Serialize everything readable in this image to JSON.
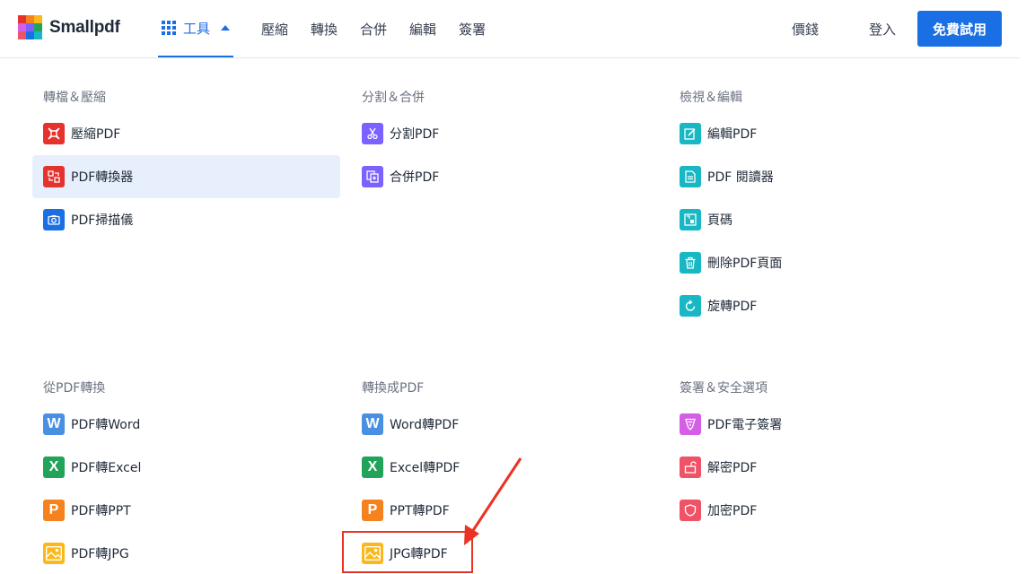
{
  "brand": {
    "name": "Smallpdf"
  },
  "nav": {
    "tools": "工具",
    "items": [
      "壓縮",
      "轉換",
      "合併",
      "編輯",
      "簽署"
    ],
    "pricing": "價錢",
    "login": "登入",
    "trial": "免費試用"
  },
  "sections": [
    {
      "title": "轉檔＆壓縮",
      "items": [
        {
          "label": "壓縮PDF",
          "icon": "compress-icon",
          "color": "#e5322d"
        },
        {
          "label": "PDF轉換器",
          "icon": "convert-icon",
          "color": "#e5322d",
          "active": true
        },
        {
          "label": "PDF掃描儀",
          "icon": "camera-icon",
          "color": "#1a6fe5"
        }
      ]
    },
    {
      "title": "分割＆合併",
      "items": [
        {
          "label": "分割PDF",
          "icon": "scissors-icon",
          "color": "#7b61ff"
        },
        {
          "label": "合併PDF",
          "icon": "merge-icon",
          "color": "#7b61ff"
        }
      ]
    },
    {
      "title": "檢視＆編輯",
      "items": [
        {
          "label": "編輯PDF",
          "icon": "edit-icon",
          "color": "#17b8c4"
        },
        {
          "label": "PDF 閱讀器",
          "icon": "reader-icon",
          "color": "#17b8c4"
        },
        {
          "label": "頁碼",
          "icon": "page-number-icon",
          "color": "#17b8c4"
        },
        {
          "label": "刪除PDF頁面",
          "icon": "trash-icon",
          "color": "#17b8c4"
        },
        {
          "label": "旋轉PDF",
          "icon": "rotate-icon",
          "color": "#17b8c4"
        }
      ]
    },
    {
      "title": "從PDF轉換",
      "items": [
        {
          "label": "PDF轉Word",
          "icon": "word-icon",
          "color": "#4a90e2",
          "glyph": "W"
        },
        {
          "label": "PDF轉Excel",
          "icon": "excel-icon",
          "color": "#21a35a",
          "glyph": "X"
        },
        {
          "label": "PDF轉PPT",
          "icon": "ppt-icon",
          "color": "#f5821f",
          "glyph": "P"
        },
        {
          "label": "PDF轉JPG",
          "icon": "image-icon",
          "color": "#fbb81b"
        }
      ]
    },
    {
      "title": "轉換成PDF",
      "items": [
        {
          "label": "Word轉PDF",
          "icon": "word-icon",
          "color": "#4a90e2",
          "glyph": "W"
        },
        {
          "label": "Excel轉PDF",
          "icon": "excel-icon",
          "color": "#21a35a",
          "glyph": "X"
        },
        {
          "label": "PPT轉PDF",
          "icon": "ppt-icon",
          "color": "#f5821f",
          "glyph": "P"
        },
        {
          "label": "JPG轉PDF",
          "icon": "image-icon",
          "color": "#fbb81b"
        }
      ]
    },
    {
      "title": "簽署＆安全選項",
      "items": [
        {
          "label": "PDF電子簽署",
          "icon": "sign-icon",
          "color": "#d55ee6"
        },
        {
          "label": "解密PDF",
          "icon": "unlock-icon",
          "color": "#f05266"
        },
        {
          "label": "加密PDF",
          "icon": "shield-icon",
          "color": "#f05266"
        }
      ]
    }
  ]
}
